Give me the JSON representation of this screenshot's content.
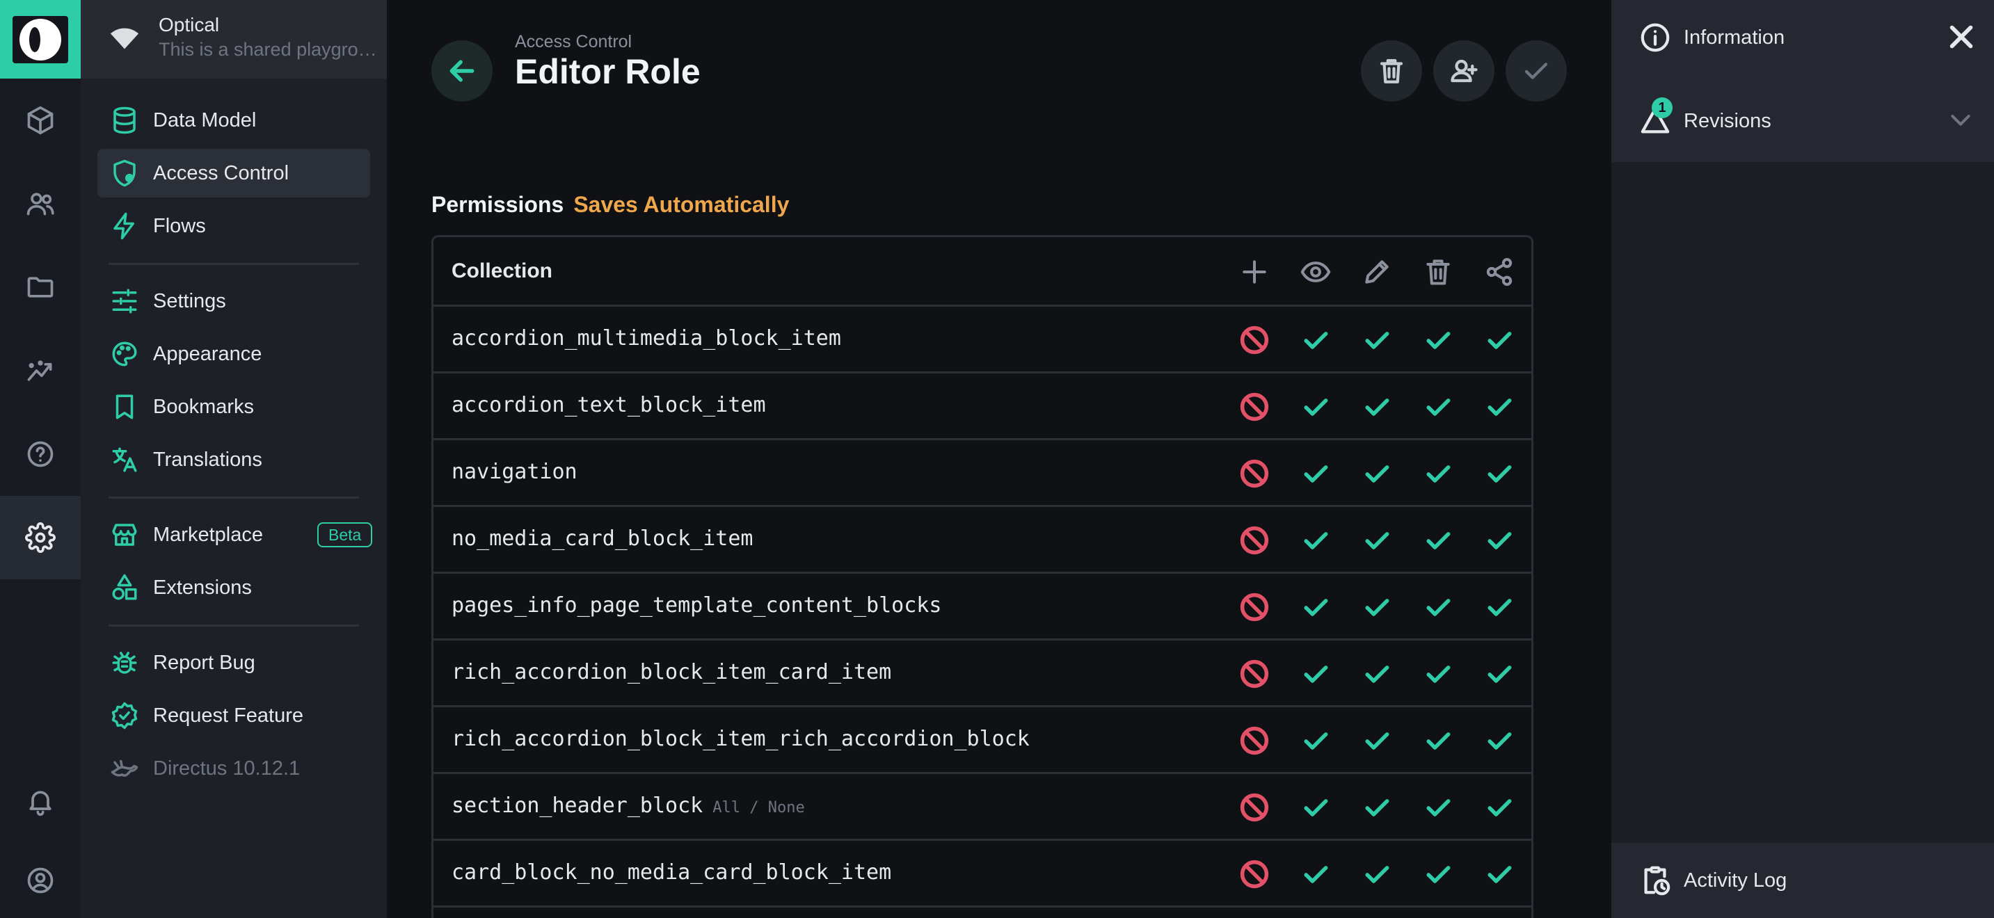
{
  "project": {
    "name": "Optical",
    "description": "This is a shared playground for testing Directus"
  },
  "modules": [
    "content",
    "users",
    "files",
    "insights",
    "help",
    "settings",
    "notifications",
    "user-profile"
  ],
  "nav": {
    "data_model": "Data Model",
    "access_control": "Access Control",
    "flows": "Flows",
    "settings": "Settings",
    "appearance": "Appearance",
    "bookmarks": "Bookmarks",
    "translations": "Translations",
    "marketplace": "Marketplace",
    "marketplace_badge": "Beta",
    "extensions": "Extensions",
    "report_bug": "Report Bug",
    "request_feature": "Request Feature",
    "version": "Directus 10.12.1"
  },
  "header": {
    "breadcrumb": "Access Control",
    "title": "Editor Role"
  },
  "permissions": {
    "label": "Permissions",
    "status": "Saves Automatically",
    "column_header": "Collection",
    "actions": [
      "create",
      "read",
      "update",
      "delete",
      "share"
    ],
    "rows": [
      {
        "collection": "accordion_multimedia_block_item",
        "hint": "",
        "create": "none",
        "read": "all",
        "update": "all",
        "delete": "all",
        "share": "all"
      },
      {
        "collection": "accordion_text_block_item",
        "hint": "",
        "create": "none",
        "read": "all",
        "update": "all",
        "delete": "all",
        "share": "all"
      },
      {
        "collection": "navigation",
        "hint": "",
        "create": "none",
        "read": "all",
        "update": "all",
        "delete": "all",
        "share": "all"
      },
      {
        "collection": "no_media_card_block_item",
        "hint": "",
        "create": "none",
        "read": "all",
        "update": "all",
        "delete": "all",
        "share": "all"
      },
      {
        "collection": "pages_info_page_template_content_blocks",
        "hint": "",
        "create": "none",
        "read": "all",
        "update": "all",
        "delete": "all",
        "share": "all"
      },
      {
        "collection": "rich_accordion_block_item_card_item",
        "hint": "",
        "create": "none",
        "read": "all",
        "update": "all",
        "delete": "all",
        "share": "all"
      },
      {
        "collection": "rich_accordion_block_item_rich_accordion_block",
        "hint": "",
        "create": "none",
        "read": "all",
        "update": "all",
        "delete": "all",
        "share": "all"
      },
      {
        "collection": "section_header_block",
        "hint": "All / None",
        "create": "none",
        "read": "all",
        "update": "all",
        "delete": "all",
        "share": "all"
      },
      {
        "collection": "card_block_no_media_card_block_item",
        "hint": "",
        "create": "none",
        "read": "all",
        "update": "all",
        "delete": "all",
        "share": "all"
      }
    ]
  },
  "sidebar": {
    "information": "Information",
    "revisions": "Revisions",
    "revisions_count": "1",
    "activity_log": "Activity Log"
  },
  "colors": {
    "accent": "#2ecda7",
    "danger": "#e35169",
    "warning": "#f0a64b"
  }
}
